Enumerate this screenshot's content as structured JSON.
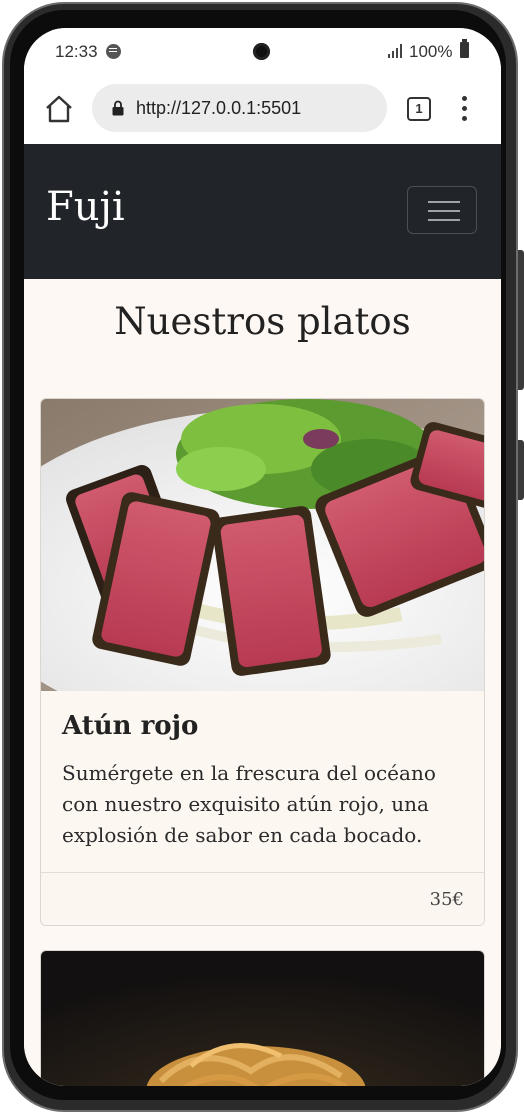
{
  "status_bar": {
    "time": "12:33",
    "battery": "100%",
    "app_icon": "spotify-icon"
  },
  "browser": {
    "url": "http://127.0.0.1:5501",
    "tab_count": "1",
    "home_icon": "home-icon",
    "lock_icon": "lock-icon",
    "menu_icon": "more-vertical-icon"
  },
  "navbar": {
    "brand": "Fuji",
    "toggler_icon": "hamburger-menu-icon"
  },
  "main": {
    "section_title": "Nuestros platos",
    "cards": [
      {
        "title": "Atún rojo",
        "description": "Sumérgete en la frescura del océano con nuestro exquisito atún rojo, una explosión de sabor en cada bocado.",
        "price": "35€"
      }
    ]
  },
  "colors": {
    "navbar_bg": "#212529",
    "page_bg": "#fdf8f4"
  }
}
